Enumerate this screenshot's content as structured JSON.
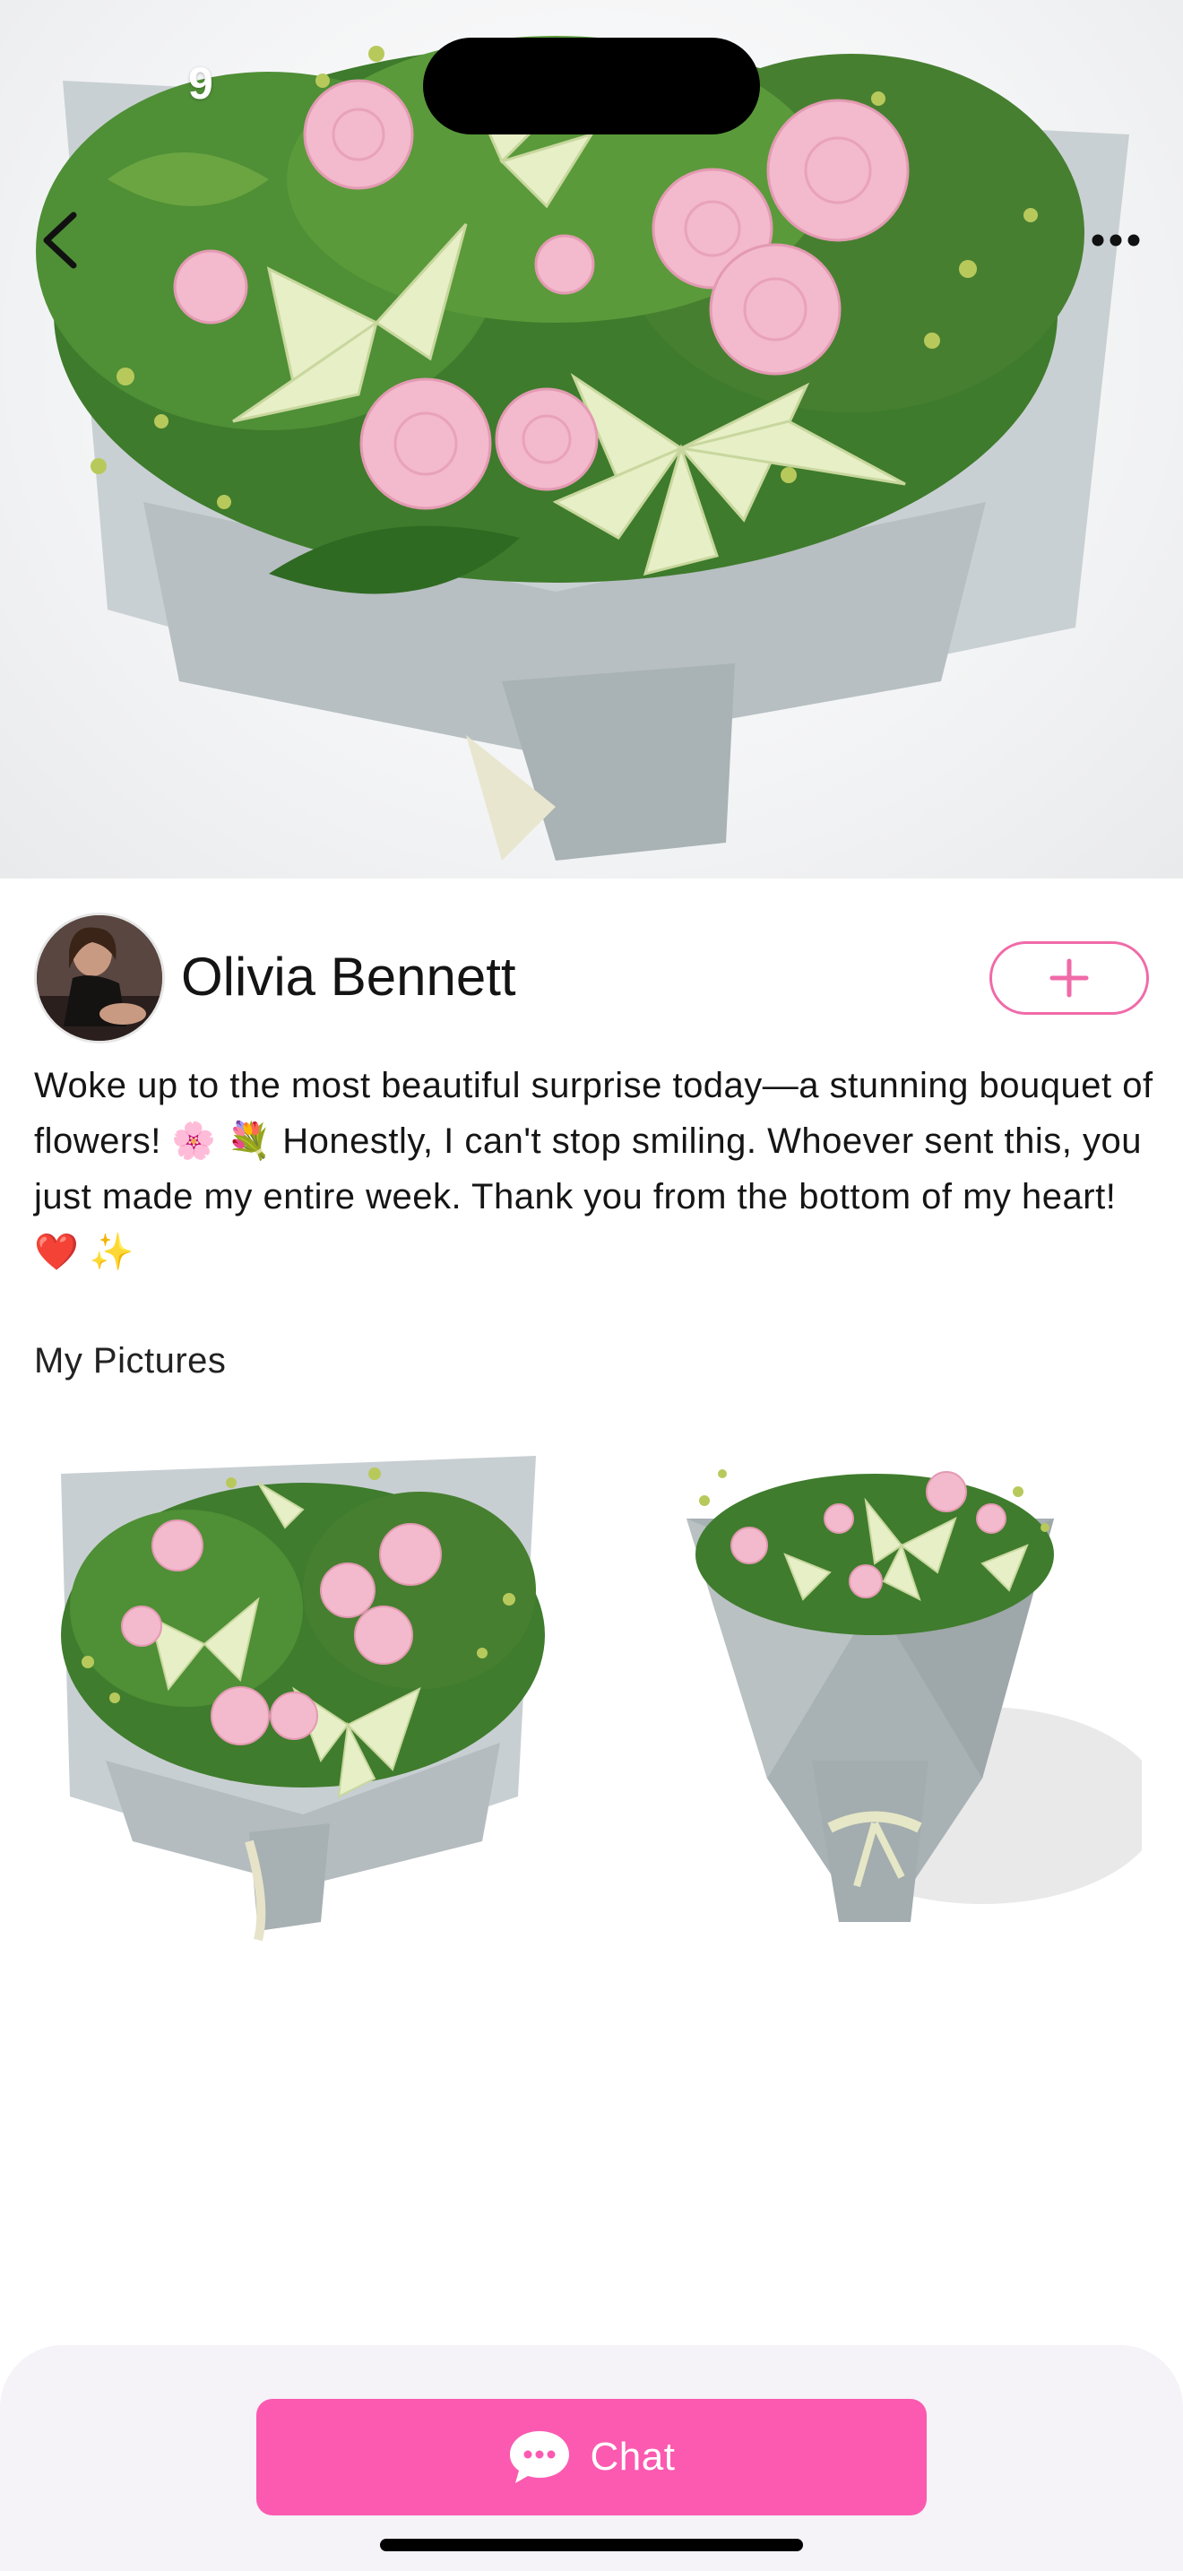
{
  "status_bar": {
    "time_fragment": "9"
  },
  "nav": {
    "back_icon": "chevron-left-icon",
    "more_icon": "ellipsis-icon"
  },
  "profile": {
    "name": "Olivia Bennett",
    "follow_icon": "plus-icon"
  },
  "post": {
    "caption": "Woke up to the most beautiful surprise today—a stunning bouquet of flowers! 🌸 💐  Honestly, I can't stop smiling. Whoever sent this, you just made my entire week. Thank you from the bottom of my heart! ❤️ ✨"
  },
  "gallery": {
    "title": "My Pictures",
    "items": [
      {
        "icon": "bouquet-photo"
      },
      {
        "icon": "bouquet-photo"
      }
    ]
  },
  "footer": {
    "chat_label": "Chat",
    "chat_icon": "chat-bubble-icon"
  },
  "colors": {
    "accent": "#fb5ab0",
    "follow_border": "#f06aa8",
    "bottom_bar": "#f5f2f8"
  }
}
